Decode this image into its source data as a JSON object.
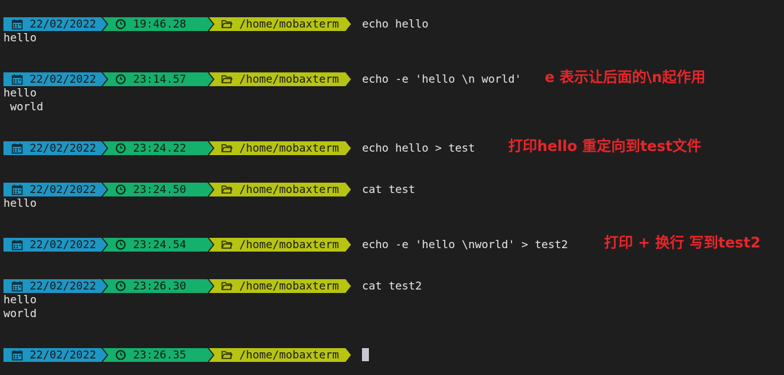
{
  "icons": {
    "date": "calendar-icon",
    "time": "clock-icon",
    "path": "folder-icon"
  },
  "colors": {
    "date_bg": "#1e96c4",
    "time_bg": "#14b06c",
    "path_bg": "#b7c412",
    "note": "#e8262a",
    "background": "#1e1e1e"
  },
  "blocks": [
    {
      "date": "22/02/2022",
      "time": "19:46.28",
      "path": "/home/mobaxterm",
      "command": "echo hello",
      "output": [
        "hello"
      ],
      "note": ""
    },
    {
      "date": "22/02/2022",
      "time": "23:14.57",
      "path": "/home/mobaxterm",
      "command": "echo -e 'hello \\n world'",
      "output": [
        "hello",
        " world"
      ],
      "note": "e 表示让后面的\\n起作用"
    },
    {
      "date": "22/02/2022",
      "time": "23:24.22",
      "path": "/home/mobaxterm",
      "command": "echo hello > test",
      "output": [],
      "note": "打印hello 重定向到test文件"
    },
    {
      "date": "22/02/2022",
      "time": "23:24.50",
      "path": "/home/mobaxterm",
      "command": "cat test",
      "output": [
        "hello"
      ],
      "note": ""
    },
    {
      "date": "22/02/2022",
      "time": "23:24.54",
      "path": "/home/mobaxterm",
      "command": "echo -e 'hello \\nworld' > test2",
      "output": [],
      "note": "打印 + 换行 写到test2"
    },
    {
      "date": "22/02/2022",
      "time": "23:26.30",
      "path": "/home/mobaxterm",
      "command": "cat test2",
      "output": [
        "hello",
        "world"
      ],
      "note": ""
    },
    {
      "date": "22/02/2022",
      "time": "23:26.35",
      "path": "/home/mobaxterm",
      "command": "",
      "output": [],
      "note": ""
    }
  ]
}
